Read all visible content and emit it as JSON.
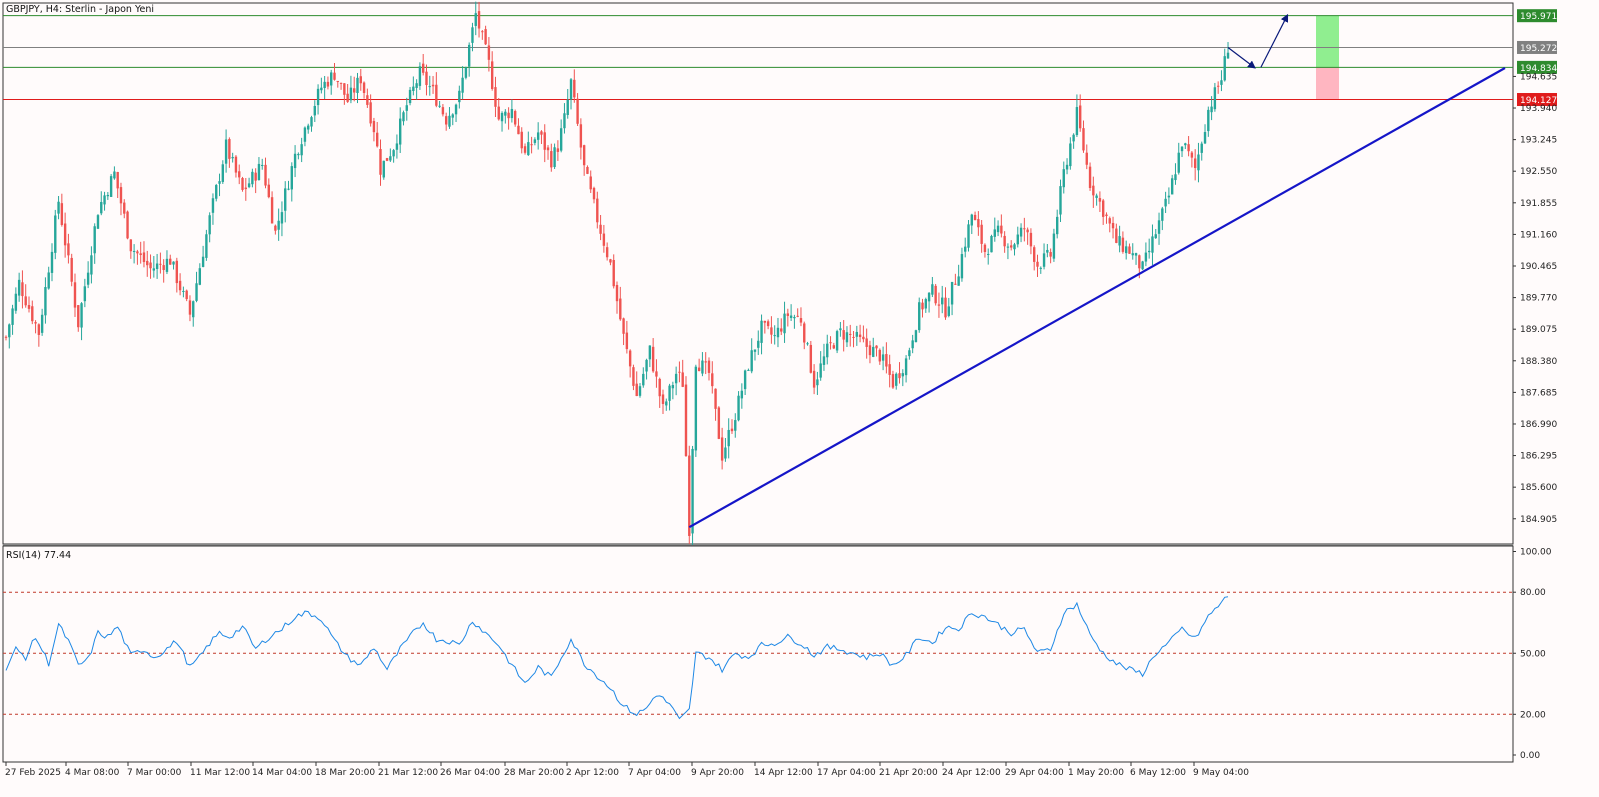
{
  "window_title": "GBPJPY, H4:  Sterlin - Japon Yeni",
  "colors": {
    "up": "#26a69a",
    "down": "#ef5350",
    "trendline": "#1515c8",
    "resistance": "#2e8b2e",
    "entry": "#808080",
    "support": "#e01b1b",
    "target_zone": "#90ee90",
    "stop_zone": "#ffb6c1",
    "rsi_line": "#1e88e5",
    "rsi_levels": "#c0392b"
  },
  "chart_data": [
    {
      "type": "candlestick",
      "symbol": "GBPJPY",
      "timeframe": "H4",
      "title": "GBPJPY, H4:  Sterlin - Japon Yeni",
      "ylim": [
        184.35,
        196.25
      ],
      "y_ticks": [
        "194.635",
        "193.940",
        "193.245",
        "192.550",
        "191.855",
        "191.160",
        "190.465",
        "189.770",
        "189.075",
        "188.380",
        "187.685",
        "186.990",
        "186.295",
        "185.600",
        "184.905"
      ],
      "x_labels": [
        "27 Feb 2025",
        "4 Mar 08:00",
        "7 Mar 00:00",
        "11 Mar 12:00",
        "14 Mar 04:00",
        "18 Mar 20:00",
        "21 Mar 12:00",
        "26 Mar 04:00",
        "28 Mar 20:00",
        "2 Apr 12:00",
        "7 Apr 04:00",
        "9 Apr 20:00",
        "14 Apr 12:00",
        "17 Apr 04:00",
        "21 Apr 20:00",
        "24 Apr 12:00",
        "29 Apr 04:00",
        "1 May 20:00",
        "6 May 12:00",
        "9 May 04:00"
      ],
      "price_path": [
        [
          0,
          188.9
        ],
        [
          4,
          190.1
        ],
        [
          10,
          189.0
        ],
        [
          16,
          191.9
        ],
        [
          22,
          189.2
        ],
        [
          28,
          191.7
        ],
        [
          33,
          192.5
        ],
        [
          38,
          190.9
        ],
        [
          44,
          190.4
        ],
        [
          50,
          190.6
        ],
        [
          56,
          189.4
        ],
        [
          62,
          191.5
        ],
        [
          67,
          193.1
        ],
        [
          72,
          192.1
        ],
        [
          78,
          192.7
        ],
        [
          82,
          191.2
        ],
        [
          88,
          192.9
        ],
        [
          92,
          193.7
        ],
        [
          96,
          194.4
        ],
        [
          100,
          194.7
        ],
        [
          104,
          194.1
        ],
        [
          108,
          194.6
        ],
        [
          112,
          193.5
        ],
        [
          114,
          192.6
        ],
        [
          118,
          193.1
        ],
        [
          122,
          194.0
        ],
        [
          126,
          194.7
        ],
        [
          130,
          194.3
        ],
        [
          134,
          193.7
        ],
        [
          138,
          194.2
        ],
        [
          143,
          196.0
        ],
        [
          147,
          194.9
        ],
        [
          150,
          193.7
        ],
        [
          154,
          193.9
        ],
        [
          158,
          192.9
        ],
        [
          162,
          193.4
        ],
        [
          166,
          192.8
        ],
        [
          168,
          193.1
        ],
        [
          170,
          193.7
        ],
        [
          172,
          194.5
        ],
        [
          176,
          192.6
        ],
        [
          180,
          191.5
        ],
        [
          184,
          190.5
        ],
        [
          188,
          188.9
        ],
        [
          192,
          187.6
        ],
        [
          196,
          188.6
        ],
        [
          200,
          187.3
        ],
        [
          204,
          188.1
        ],
        [
          206,
          187.9
        ],
        [
          208,
          184.7
        ],
        [
          210,
          188.4
        ],
        [
          214,
          188.1
        ],
        [
          218,
          186.3
        ],
        [
          222,
          187.2
        ],
        [
          226,
          188.3
        ],
        [
          230,
          189.1
        ],
        [
          234,
          188.9
        ],
        [
          238,
          189.4
        ],
        [
          242,
          189.3
        ],
        [
          246,
          187.9
        ],
        [
          250,
          188.6
        ],
        [
          254,
          189.0
        ],
        [
          258,
          188.9
        ],
        [
          262,
          188.7
        ],
        [
          266,
          188.5
        ],
        [
          270,
          187.9
        ],
        [
          274,
          188.4
        ],
        [
          278,
          189.5
        ],
        [
          282,
          189.9
        ],
        [
          286,
          189.5
        ],
        [
          290,
          190.4
        ],
        [
          294,
          191.6
        ],
        [
          298,
          190.8
        ],
        [
          302,
          191.2
        ],
        [
          306,
          190.9
        ],
        [
          310,
          191.3
        ],
        [
          314,
          190.5
        ],
        [
          318,
          190.7
        ],
        [
          322,
          192.5
        ],
        [
          326,
          193.8
        ],
        [
          330,
          192.3
        ],
        [
          334,
          191.7
        ],
        [
          338,
          191.0
        ],
        [
          342,
          190.8
        ],
        [
          346,
          190.4
        ],
        [
          350,
          191.2
        ],
        [
          354,
          192.0
        ],
        [
          358,
          193.2
        ],
        [
          362,
          192.6
        ],
        [
          366,
          193.9
        ],
        [
          370,
          194.6
        ],
        [
          372,
          195.3
        ]
      ],
      "levels": [
        {
          "price": 195.971,
          "label": "195.971"
        },
        {
          "price": 195.272,
          "label": "195.272"
        },
        {
          "price": 194.834,
          "label": "194.834"
        },
        {
          "price": 194.127,
          "label": "194.127"
        }
      ],
      "trendline": {
        "from": [
          208,
          184.72
        ],
        "to_price_at_right": 194.82
      },
      "projection_arrows": [
        {
          "from": [
            372,
            195.272
          ],
          "to": [
            380,
            194.834
          ]
        },
        {
          "from": [
            382,
            194.834
          ],
          "to": [
            390,
            195.971
          ]
        }
      ],
      "zones": {
        "target": [
          194.834,
          195.971
        ],
        "stop": [
          194.127,
          194.834
        ]
      }
    },
    {
      "type": "line",
      "indicator": "RSI",
      "label": "RSI(14) 77.44",
      "ylim": [
        0,
        100
      ],
      "y_ticks": [
        "100.00",
        "80.00",
        "50.00",
        "20.00",
        "0.00"
      ],
      "levels": [
        80,
        50,
        20
      ],
      "values_path": [
        [
          0,
          42
        ],
        [
          3,
          52
        ],
        [
          6,
          48
        ],
        [
          9,
          58
        ],
        [
          13,
          45
        ],
        [
          16,
          64
        ],
        [
          19,
          56
        ],
        [
          22,
          44
        ],
        [
          25,
          47
        ],
        [
          28,
          60
        ],
        [
          31,
          58
        ],
        [
          34,
          63
        ],
        [
          38,
          49
        ],
        [
          42,
          52
        ],
        [
          45,
          48
        ],
        [
          48,
          51
        ],
        [
          52,
          56
        ],
        [
          56,
          43
        ],
        [
          59,
          48
        ],
        [
          62,
          55
        ],
        [
          65,
          60
        ],
        [
          68,
          58
        ],
        [
          72,
          63
        ],
        [
          76,
          52
        ],
        [
          80,
          58
        ],
        [
          84,
          62
        ],
        [
          88,
          68
        ],
        [
          92,
          70
        ],
        [
          96,
          67
        ],
        [
          100,
          56
        ],
        [
          104,
          48
        ],
        [
          108,
          44
        ],
        [
          112,
          53
        ],
        [
          116,
          42
        ],
        [
          120,
          52
        ],
        [
          124,
          60
        ],
        [
          127,
          65
        ],
        [
          131,
          57
        ],
        [
          135,
          56
        ],
        [
          138,
          54
        ],
        [
          142,
          66
        ],
        [
          146,
          60
        ],
        [
          150,
          54
        ],
        [
          154,
          44
        ],
        [
          158,
          35
        ],
        [
          162,
          43
        ],
        [
          166,
          38
        ],
        [
          169,
          48
        ],
        [
          172,
          57
        ],
        [
          176,
          45
        ],
        [
          180,
          39
        ],
        [
          184,
          33
        ],
        [
          188,
          24
        ],
        [
          192,
          20
        ],
        [
          195,
          23
        ],
        [
          198,
          30
        ],
        [
          202,
          25
        ],
        [
          205,
          17
        ],
        [
          208,
          22
        ],
        [
          210,
          50
        ],
        [
          214,
          48
        ],
        [
          218,
          42
        ],
        [
          222,
          50
        ],
        [
          226,
          48
        ],
        [
          230,
          54
        ],
        [
          234,
          55
        ],
        [
          238,
          58
        ],
        [
          242,
          55
        ],
        [
          246,
          49
        ],
        [
          250,
          53
        ],
        [
          254,
          52
        ],
        [
          258,
          50
        ],
        [
          262,
          48
        ],
        [
          266,
          50
        ],
        [
          270,
          44
        ],
        [
          274,
          49
        ],
        [
          278,
          58
        ],
        [
          282,
          55
        ],
        [
          286,
          63
        ],
        [
          290,
          62
        ],
        [
          294,
          70
        ],
        [
          298,
          68
        ],
        [
          302,
          64
        ],
        [
          306,
          60
        ],
        [
          310,
          62
        ],
        [
          314,
          50
        ],
        [
          318,
          52
        ],
        [
          322,
          70
        ],
        [
          326,
          74
        ],
        [
          330,
          59
        ],
        [
          334,
          50
        ],
        [
          338,
          45
        ],
        [
          342,
          42
        ],
        [
          346,
          40
        ],
        [
          350,
          50
        ],
        [
          354,
          55
        ],
        [
          358,
          62
        ],
        [
          362,
          57
        ],
        [
          366,
          68
        ],
        [
          370,
          75
        ],
        [
          372,
          78
        ]
      ],
      "last_value": 77.44
    }
  ]
}
